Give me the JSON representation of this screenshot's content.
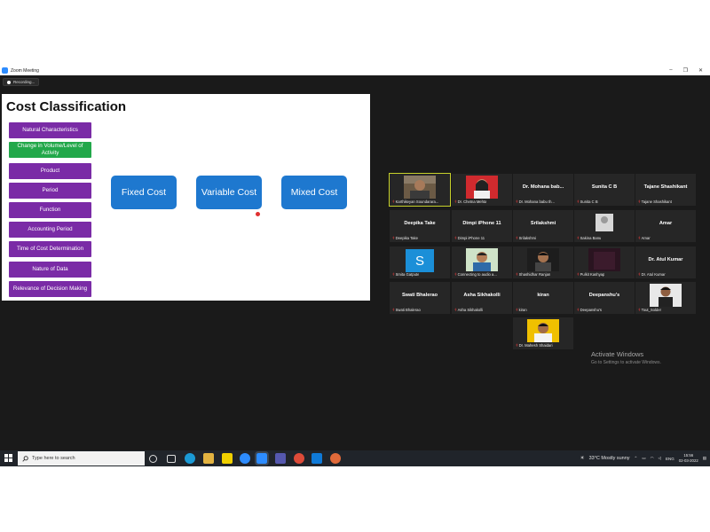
{
  "window": {
    "title": "Zoom Meeting",
    "recording_label": "Recording...",
    "controls": [
      "–",
      "❐",
      "✕"
    ]
  },
  "slide": {
    "title": "Cost Classification",
    "purple_buttons": [
      "Natural Characteristics",
      "Change in Volume/Level of Activity",
      "Product",
      "Period",
      "Function",
      "Accounting Period",
      "Time of Cost Determination",
      "Nature of Data",
      "Relevance of Decision Making"
    ],
    "highlighted_index": 1,
    "cost_types": [
      "Fixed Cost",
      "Variable Cost",
      "Mixed Cost"
    ]
  },
  "participants": [
    {
      "big": "",
      "label": "Karthikeyan Soundarara...",
      "photo": "man"
    },
    {
      "big": "",
      "label": "Dr. Chetna Mehta",
      "photo": "woman"
    },
    {
      "big": "Dr. Mohana bab...",
      "label": "Dr. Mohana babu th..."
    },
    {
      "big": "Sunita C B",
      "label": "Sunita C B"
    },
    {
      "big": "Tajane Shashikant",
      "label": "Tajane Shashikant"
    },
    {
      "big": "Deepika Take",
      "label": "Deepika Take"
    },
    {
      "big": "Dimpi iPhone 11",
      "label": "Dimpi iPhone 11"
    },
    {
      "big": "Srilakshmi",
      "label": "Srilakshmi"
    },
    {
      "big": "",
      "label": "Sakina Banu",
      "photo": "generic"
    },
    {
      "big": "Amar",
      "label": "Amar"
    },
    {
      "big": "",
      "label": "Smita Gatpute",
      "photo": "S"
    },
    {
      "big": "",
      "label": "Connecting to audio a...",
      "photo": "man2"
    },
    {
      "big": "",
      "label": "Shashidhar Ranjan",
      "photo": "man3"
    },
    {
      "big": "",
      "label": "Pulkit Kashyap",
      "photo": "dark"
    },
    {
      "big": "Dr. Atul Kumar",
      "label": "Dr. Atul Kumar"
    },
    {
      "big": "Swati Bhalerao",
      "label": "Swati Bhalerao"
    },
    {
      "big": "Asha Sikhakolli",
      "label": "Asha Sikhakolli"
    },
    {
      "big": "kiran",
      "label": "kiran"
    },
    {
      "big": "Deepanshu's",
      "label": "Deepanshu's"
    },
    {
      "big": "",
      "label": "Tout_Solder",
      "photo": "man4"
    },
    {
      "big": "",
      "label": "Dr. Mahesh Shaidari",
      "photo": "man5"
    }
  ],
  "activate_windows": {
    "line1": "Activate Windows",
    "line2": "Go to Settings to activate Windows."
  },
  "taskbar": {
    "search_placeholder": "Type here to search",
    "weather": "33°C  Mostly sunny",
    "language": "ENG",
    "time": "15:56",
    "date": "02-03-2022"
  },
  "colors": {
    "slide_purple": "#7a2ba6",
    "slide_green": "#22a84a",
    "slide_blue": "#1e78cf",
    "zoom_background": "#1a1a1a"
  }
}
